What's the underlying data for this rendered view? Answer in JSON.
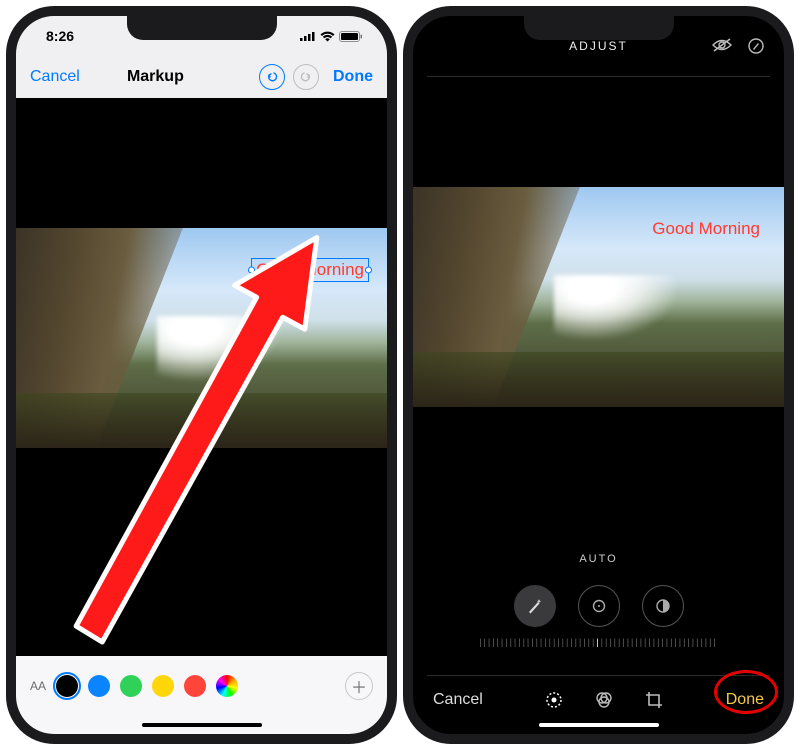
{
  "left": {
    "status": {
      "time": "8:26"
    },
    "toolbar": {
      "cancel": "Cancel",
      "title": "Markup",
      "done": "Done"
    },
    "textbox": "Good Morning",
    "palette": {
      "aa": "AA",
      "colors": [
        "#000000",
        "#0a84ff",
        "#30d158",
        "#ffd60a",
        "#ff453a"
      ],
      "selected_index": 0
    }
  },
  "right": {
    "header": {
      "title": "ADJUST"
    },
    "overlay_text": "Good Morning",
    "auto_label": "AUTO",
    "footer": {
      "cancel": "Cancel",
      "done": "Done"
    }
  }
}
